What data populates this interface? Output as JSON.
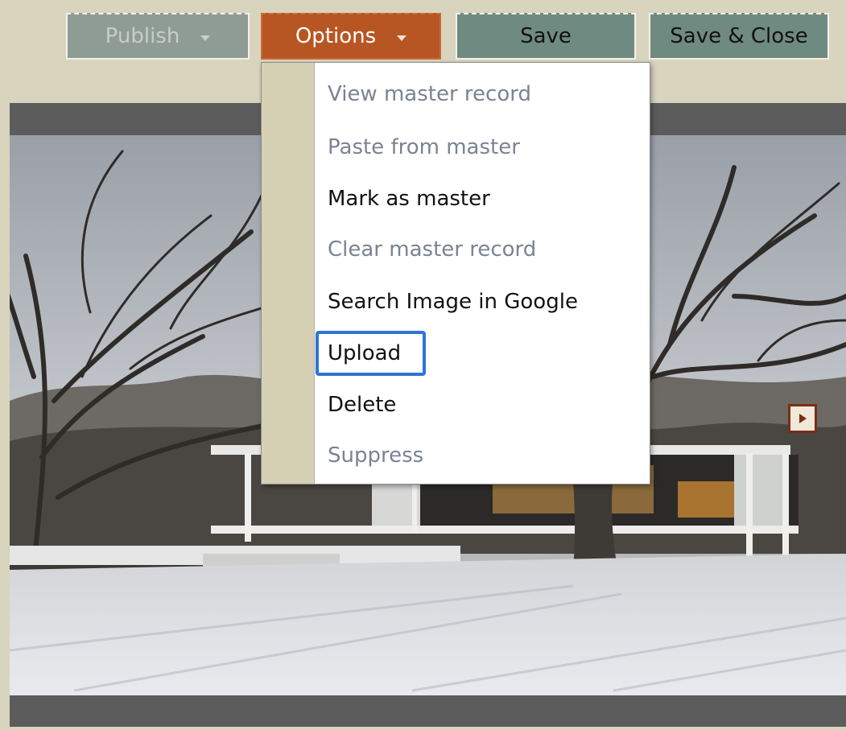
{
  "toolbar": {
    "publish_label": "Publish",
    "options_label": "Options",
    "save_label": "Save",
    "save_close_label": "Save & Close"
  },
  "options_menu": {
    "items": [
      {
        "label": "View master record",
        "enabled": false
      },
      {
        "label": "Paste from master",
        "enabled": false
      },
      {
        "label": "Mark as master",
        "enabled": true
      },
      {
        "label": "Clear master record",
        "enabled": false
      },
      {
        "label": "Search Image in Google",
        "enabled": true
      },
      {
        "label": "Upload",
        "enabled": true,
        "focused": true
      },
      {
        "label": "Delete",
        "enabled": true
      },
      {
        "label": "Suppress",
        "enabled": false
      }
    ]
  },
  "colors": {
    "options_accent": "#b85623",
    "focus_ring": "#2d74d6",
    "button_green": "#6f8a80",
    "background": "#d9d4be"
  },
  "icons": {
    "next_arrow": "triangle-right-icon",
    "dropdown_caret": "caret-down-icon"
  }
}
